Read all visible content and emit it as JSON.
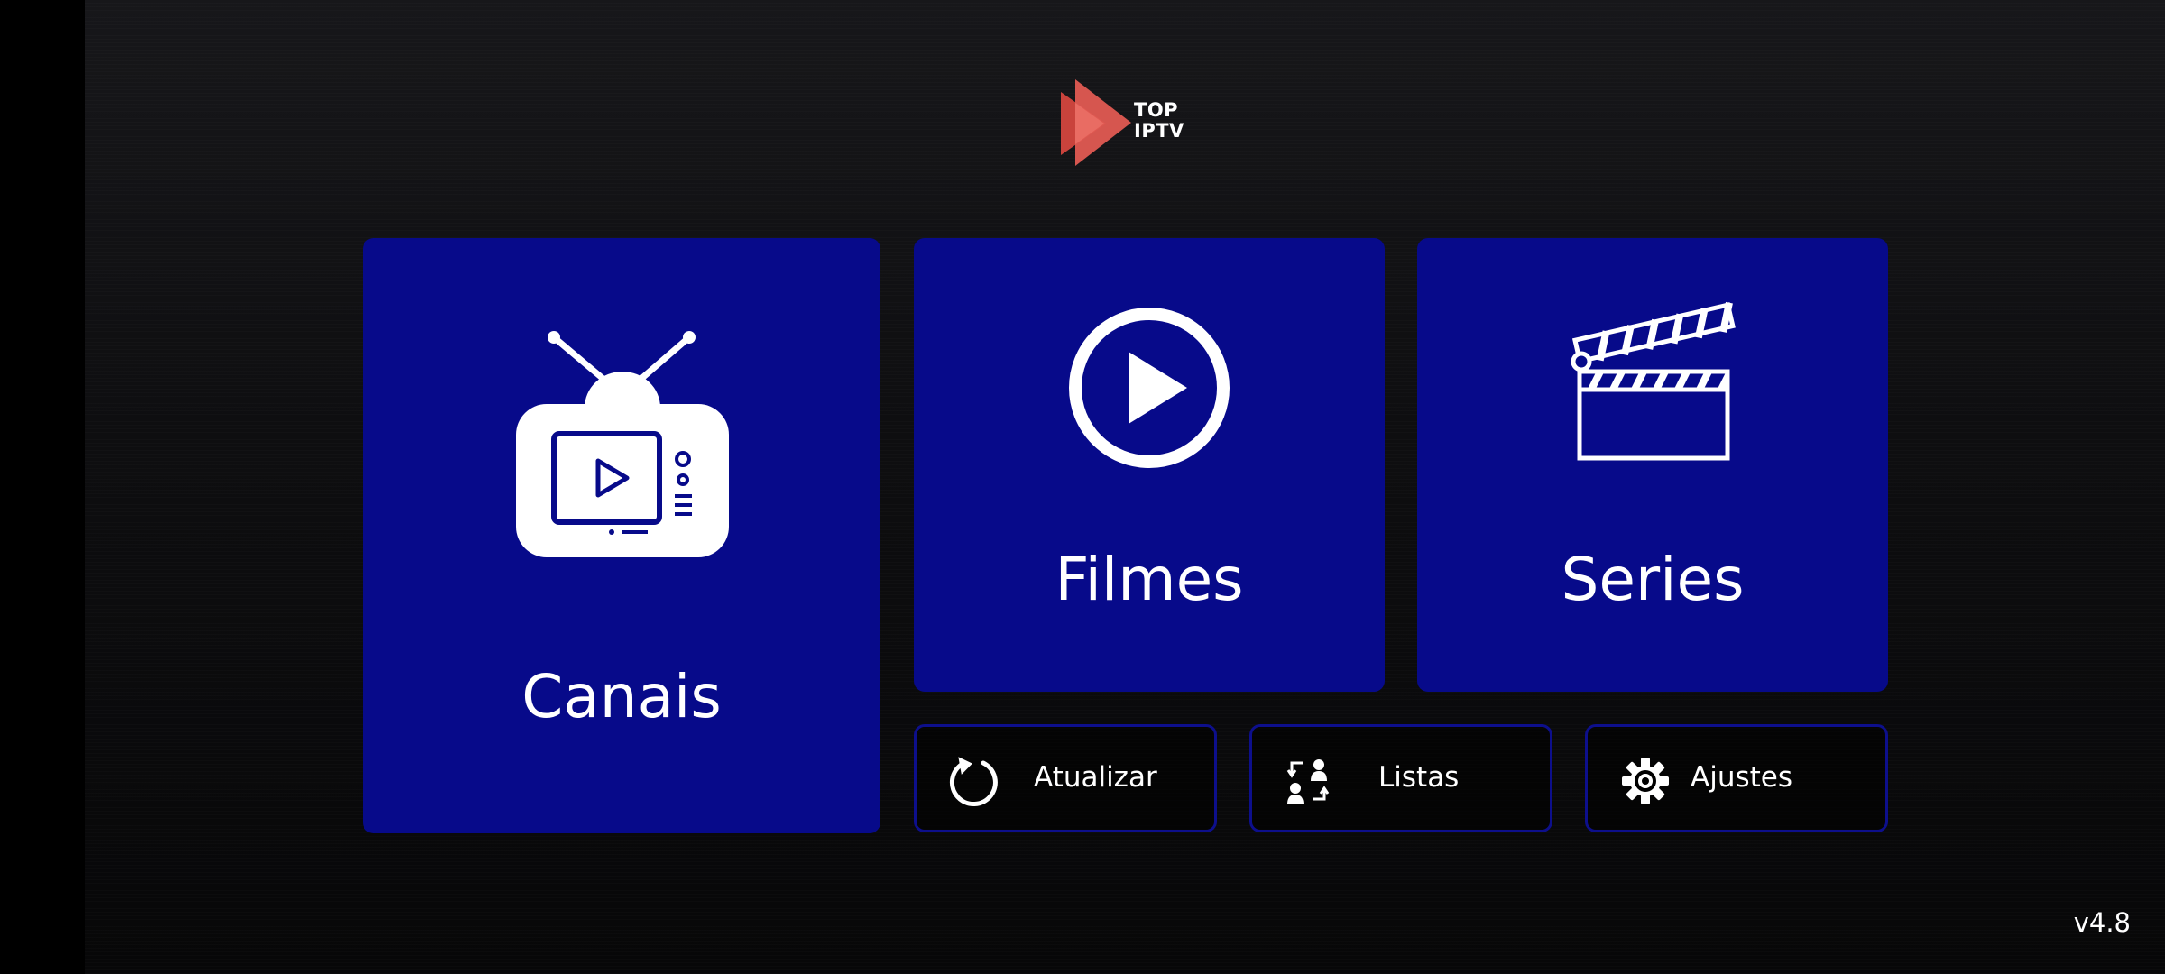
{
  "logo": {
    "line1": "TOP",
    "line2": "IPTV",
    "icon": "play-logo-icon"
  },
  "tiles": {
    "canais": {
      "label": "Canais",
      "icon": "tv-icon"
    },
    "filmes": {
      "label": "Filmes",
      "icon": "play-circle-icon"
    },
    "series": {
      "label": "Series",
      "icon": "clapperboard-icon"
    }
  },
  "buttons": {
    "atualizar": {
      "label": "Atualizar",
      "icon": "refresh-icon"
    },
    "listas": {
      "label": "Listas",
      "icon": "switch-user-icon"
    },
    "ajustes": {
      "label": "Ajustes",
      "icon": "gear-icon"
    }
  },
  "version": "v4.8",
  "colors": {
    "tile": "#070a8a",
    "button_border": "#0d0f8c",
    "logo": "#d9534a",
    "background": "#0e0e10"
  }
}
